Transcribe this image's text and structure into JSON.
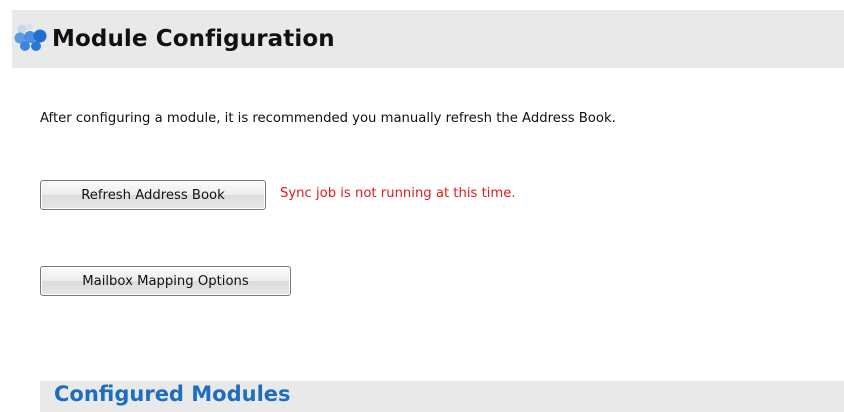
{
  "header": {
    "title": "Module Configuration",
    "icon": "cubes-icon",
    "accent_colors": [
      "#1e6fd1",
      "#5a9be6",
      "#c9d8ec"
    ]
  },
  "main": {
    "intro_text": "After configuring a module, it is recommended you manually refresh the Address Book.",
    "refresh_button_label": "Refresh Address Book",
    "sync_status_text": "Sync job is not running at this time.",
    "sync_status_color": "#e21b1b",
    "mailbox_button_label": "Mailbox Mapping Options"
  },
  "configured_modules": {
    "title": "Configured Modules",
    "title_color": "#1d6ec0"
  }
}
